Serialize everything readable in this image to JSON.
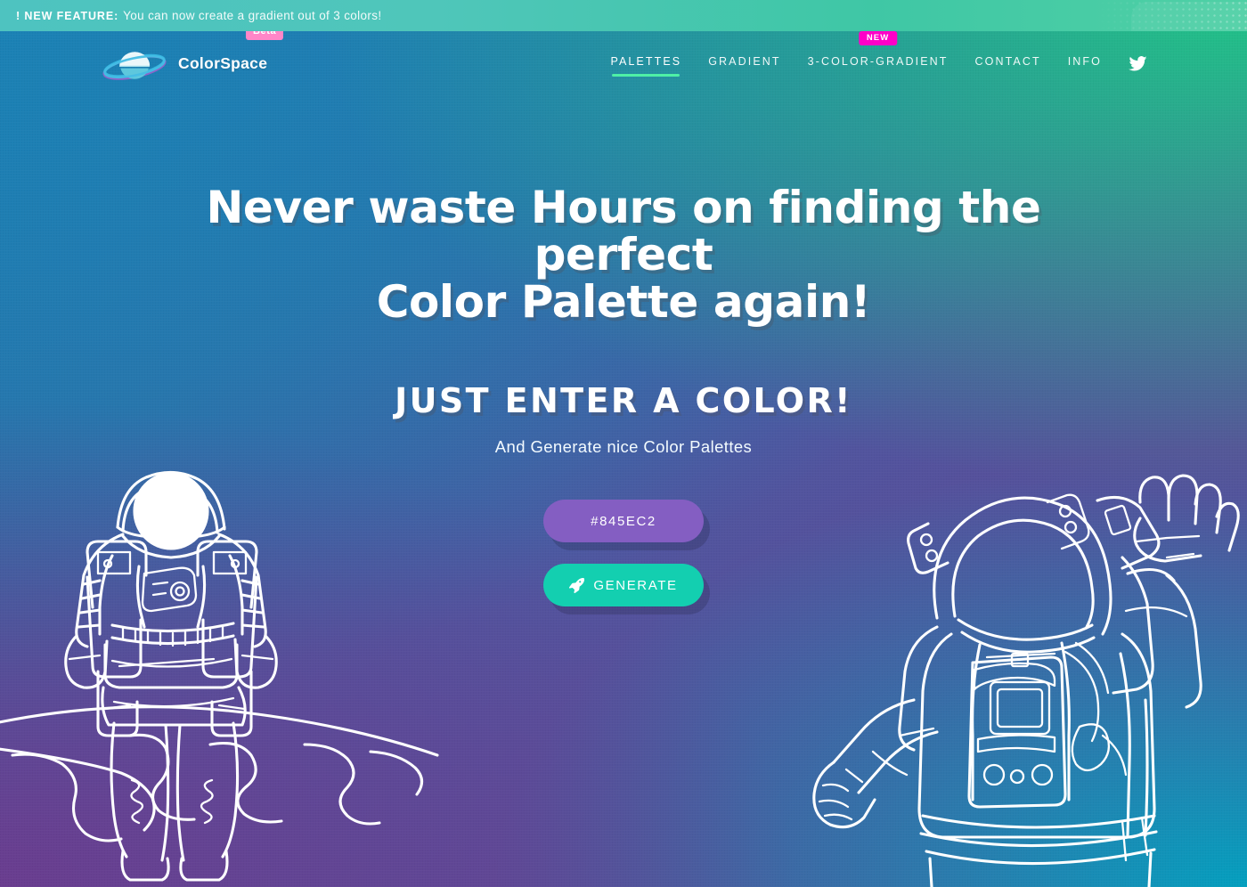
{
  "banner": {
    "strong": "! NEW FEATURE:",
    "text": "You can now create a gradient out of 3 colors!"
  },
  "header": {
    "brand_name": "ColorSpace",
    "beta_badge": "Beta",
    "logo_icon": "saturn-planet-icon",
    "nav": [
      {
        "label": "PALETTES",
        "active": true,
        "badge": null
      },
      {
        "label": "GRADIENT",
        "active": false,
        "badge": null
      },
      {
        "label": "3-COLOR-GRADIENT",
        "active": false,
        "badge": "NEW"
      },
      {
        "label": "CONTACT",
        "active": false,
        "badge": null
      },
      {
        "label": "INFO",
        "active": false,
        "badge": null
      }
    ],
    "twitter_icon": "twitter-bird-icon"
  },
  "hero": {
    "title_line_1": "Never waste Hours on finding the perfect",
    "title_line_2": "Color Palette again!",
    "subheading": "JUST ENTER A COLOR!",
    "tagline": "And Generate nice Color Palettes"
  },
  "actions": {
    "color_value": "#845EC2",
    "generate_label": "GENERATE",
    "generate_icon": "rocket-icon"
  },
  "colors": {
    "color_button_bg": "#845EC2",
    "generate_button_bg": "#13CFB0",
    "nav_active_underline": "#4EF0A6",
    "new_badge_bg": "#FF00C8",
    "beta_badge_bg": "#FF86C8",
    "banner_bg_start": "#4EC3C0",
    "banner_bg_end": "#4FD0A5",
    "bg_top_left": "#1B82B5",
    "bg_top_right": "#20C487",
    "bg_bottom_left": "#6A3D8F",
    "bg_bottom_right": "#04A0BF"
  },
  "illustrations": {
    "left": "astronaut-standing-on-planet",
    "right": "astronaut-waving"
  }
}
